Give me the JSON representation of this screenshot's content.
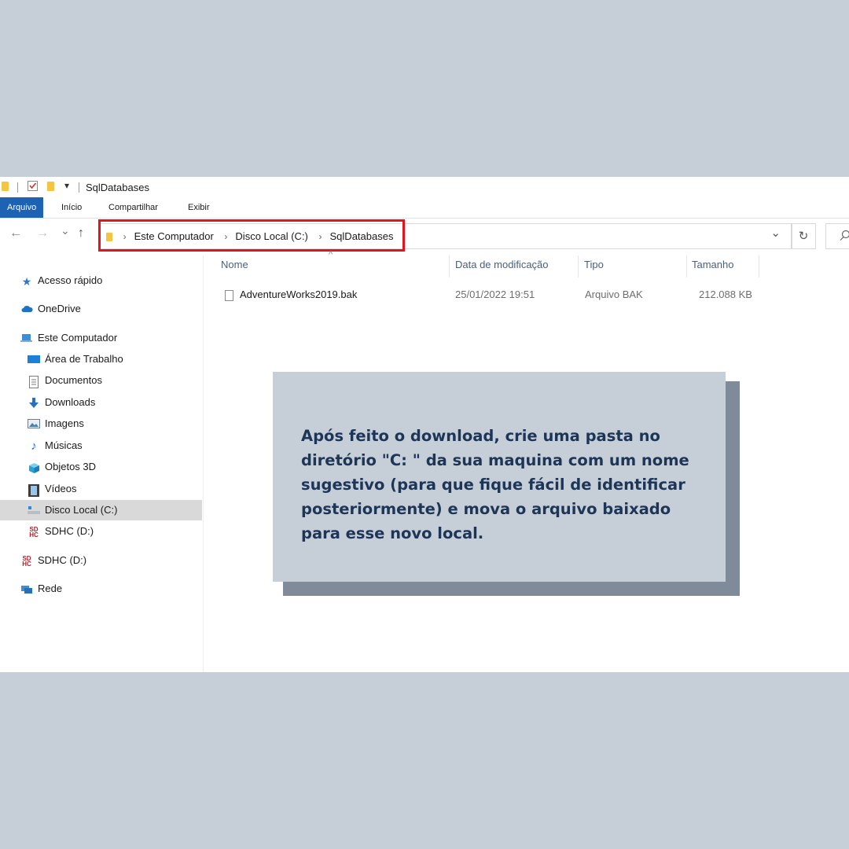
{
  "window": {
    "title": "SqlDatabases",
    "quick_access_dropdown": "▾"
  },
  "ribbon": {
    "tabs": [
      {
        "label": "Arquivo",
        "active": true
      },
      {
        "label": "Início",
        "active": false
      },
      {
        "label": "Compartilhar",
        "active": false
      },
      {
        "label": "Exibir",
        "active": false
      }
    ]
  },
  "nav_buttons": {
    "back": "←",
    "forward": "→",
    "recent": "⌄",
    "up": "↑"
  },
  "address_bar": {
    "breadcrumbs": [
      "Este Computador",
      "Disco Local (C:)",
      "SqlDatabases"
    ],
    "separator": "›",
    "dropdown": "⌄",
    "refresh": "↻",
    "highlight_color": "#e4141c"
  },
  "sidebar": {
    "items": [
      {
        "label": "Acesso rápido",
        "icon": "star-icon"
      },
      {
        "label": "OneDrive",
        "icon": "cloud-icon"
      },
      {
        "label": "Este Computador",
        "icon": "computer-icon"
      },
      {
        "label": "Área de Trabalho",
        "icon": "desktop-icon"
      },
      {
        "label": "Documentos",
        "icon": "documents-icon"
      },
      {
        "label": "Downloads",
        "icon": "download-icon"
      },
      {
        "label": "Imagens",
        "icon": "pictures-icon"
      },
      {
        "label": "Músicas",
        "icon": "music-icon"
      },
      {
        "label": "Objetos 3D",
        "icon": "cube-icon"
      },
      {
        "label": "Vídeos",
        "icon": "video-icon"
      },
      {
        "label": "Disco Local (C:)",
        "icon": "drive-icon",
        "selected": true
      },
      {
        "label": "SDHC (D:)",
        "icon": "sd-card-icon"
      },
      {
        "label": "SDHC (D:)",
        "icon": "sd-card-icon"
      },
      {
        "label": "Rede",
        "icon": "network-icon"
      }
    ]
  },
  "file_list": {
    "columns": [
      "Nome",
      "Data de modificação",
      "Tipo",
      "Tamanho"
    ],
    "sort_indicator": "^",
    "files": [
      {
        "name": "AdventureWorks2019.bak",
        "modified": "25/01/2022 19:51",
        "type": "Arquivo BAK",
        "size": "212.088 KB"
      }
    ]
  },
  "callout": {
    "text": "Após feito o download, crie uma pasta no diretório \"C: \" da sua maquina com um nome sugestivo (para que fique fácil de identificar posteriormente) e mova o arquivo baixado para esse novo local."
  },
  "colors": {
    "background": "#c6ced8",
    "callout_text": "#1d3657",
    "callout_shadow": "#7f8b98",
    "ribbon_active": "#1e62b4"
  }
}
